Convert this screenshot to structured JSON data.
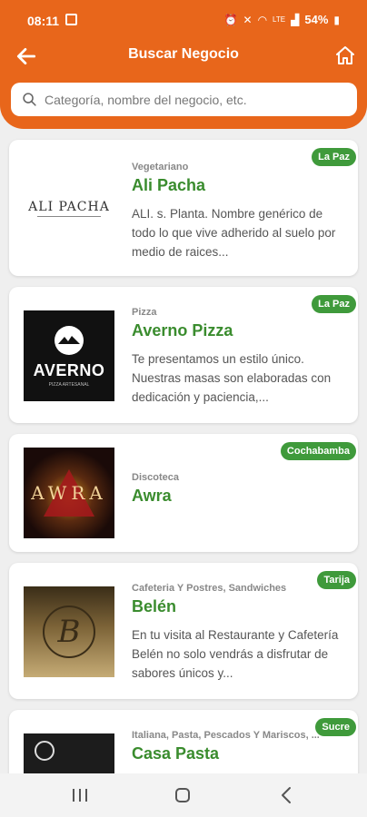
{
  "status": {
    "time": "08:11",
    "battery": "54%",
    "network": "LTE"
  },
  "header": {
    "title": "Buscar Negocio"
  },
  "search": {
    "placeholder": "Categoría, nombre del negocio, etc."
  },
  "colors": {
    "brand": "#e8661b",
    "accent": "#3a8c2e",
    "badge": "#3f9a3b"
  },
  "businesses": [
    {
      "category": "Vegetariano",
      "name": "Ali Pacha",
      "location": "La Paz",
      "description": "ALI. s. Planta. Nombre genérico de todo lo que vive adherido al suelo por medio de raices...",
      "logo_text": "ALI PACHA",
      "logo_icon": "ali-pacha-logo"
    },
    {
      "category": "Pizza",
      "name": "Averno Pizza",
      "location": "La Paz",
      "description": "Te presentamos un estilo único. Nuestras masas son elaboradas con dedicación y paciencia,...",
      "logo_text": "AVERNO",
      "logo_subtext": "PIZZA ARTESANAL",
      "logo_icon": "averno-logo"
    },
    {
      "category": "Discoteca",
      "name": "Awra",
      "location": "Cochabamba",
      "description": "",
      "logo_text": "AWRA",
      "logo_icon": "awra-logo"
    },
    {
      "category": "Cafeteria Y Postres, Sandwiches",
      "name": "Belén",
      "location": "Tarija",
      "description": "En tu visita al Restaurante y Cafetería Belén no solo vendrás a disfrutar de sabores únicos y...",
      "logo_text": "B",
      "logo_icon": "belen-logo"
    },
    {
      "category": "Italiana, Pasta, Pescados Y Mariscos, ...",
      "name": "Casa Pasta",
      "location": "Sucre",
      "description": "",
      "logo_icon": "casa-pasta-logo"
    }
  ]
}
